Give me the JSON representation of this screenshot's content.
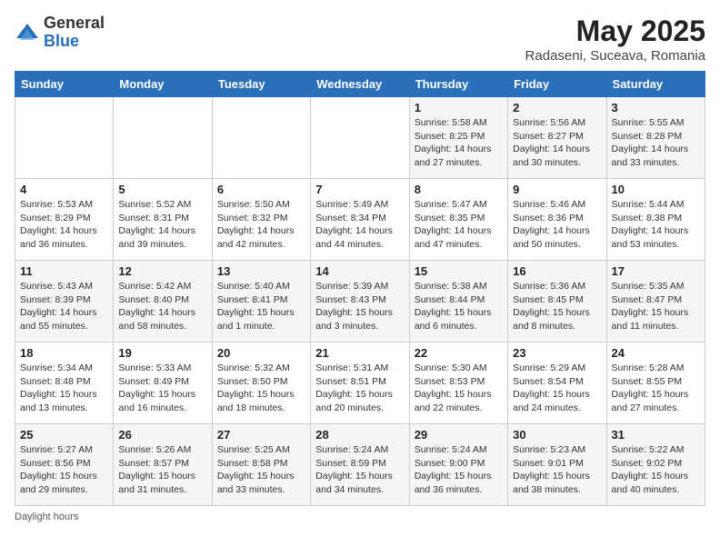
{
  "header": {
    "logo_general": "General",
    "logo_blue": "Blue",
    "month_title": "May 2025",
    "location": "Radaseni, Suceava, Romania"
  },
  "days_of_week": [
    "Sunday",
    "Monday",
    "Tuesday",
    "Wednesday",
    "Thursday",
    "Friday",
    "Saturday"
  ],
  "weeks": [
    [
      {
        "day": "",
        "info": ""
      },
      {
        "day": "",
        "info": ""
      },
      {
        "day": "",
        "info": ""
      },
      {
        "day": "",
        "info": ""
      },
      {
        "day": "1",
        "info": "Sunrise: 5:58 AM\nSunset: 8:25 PM\nDaylight: 14 hours\nand 27 minutes."
      },
      {
        "day": "2",
        "info": "Sunrise: 5:56 AM\nSunset: 8:27 PM\nDaylight: 14 hours\nand 30 minutes."
      },
      {
        "day": "3",
        "info": "Sunrise: 5:55 AM\nSunset: 8:28 PM\nDaylight: 14 hours\nand 33 minutes."
      }
    ],
    [
      {
        "day": "4",
        "info": "Sunrise: 5:53 AM\nSunset: 8:29 PM\nDaylight: 14 hours\nand 36 minutes."
      },
      {
        "day": "5",
        "info": "Sunrise: 5:52 AM\nSunset: 8:31 PM\nDaylight: 14 hours\nand 39 minutes."
      },
      {
        "day": "6",
        "info": "Sunrise: 5:50 AM\nSunset: 8:32 PM\nDaylight: 14 hours\nand 42 minutes."
      },
      {
        "day": "7",
        "info": "Sunrise: 5:49 AM\nSunset: 8:34 PM\nDaylight: 14 hours\nand 44 minutes."
      },
      {
        "day": "8",
        "info": "Sunrise: 5:47 AM\nSunset: 8:35 PM\nDaylight: 14 hours\nand 47 minutes."
      },
      {
        "day": "9",
        "info": "Sunrise: 5:46 AM\nSunset: 8:36 PM\nDaylight: 14 hours\nand 50 minutes."
      },
      {
        "day": "10",
        "info": "Sunrise: 5:44 AM\nSunset: 8:38 PM\nDaylight: 14 hours\nand 53 minutes."
      }
    ],
    [
      {
        "day": "11",
        "info": "Sunrise: 5:43 AM\nSunset: 8:39 PM\nDaylight: 14 hours\nand 55 minutes."
      },
      {
        "day": "12",
        "info": "Sunrise: 5:42 AM\nSunset: 8:40 PM\nDaylight: 14 hours\nand 58 minutes."
      },
      {
        "day": "13",
        "info": "Sunrise: 5:40 AM\nSunset: 8:41 PM\nDaylight: 15 hours\nand 1 minute."
      },
      {
        "day": "14",
        "info": "Sunrise: 5:39 AM\nSunset: 8:43 PM\nDaylight: 15 hours\nand 3 minutes."
      },
      {
        "day": "15",
        "info": "Sunrise: 5:38 AM\nSunset: 8:44 PM\nDaylight: 15 hours\nand 6 minutes."
      },
      {
        "day": "16",
        "info": "Sunrise: 5:36 AM\nSunset: 8:45 PM\nDaylight: 15 hours\nand 8 minutes."
      },
      {
        "day": "17",
        "info": "Sunrise: 5:35 AM\nSunset: 8:47 PM\nDaylight: 15 hours\nand 11 minutes."
      }
    ],
    [
      {
        "day": "18",
        "info": "Sunrise: 5:34 AM\nSunset: 8:48 PM\nDaylight: 15 hours\nand 13 minutes."
      },
      {
        "day": "19",
        "info": "Sunrise: 5:33 AM\nSunset: 8:49 PM\nDaylight: 15 hours\nand 16 minutes."
      },
      {
        "day": "20",
        "info": "Sunrise: 5:32 AM\nSunset: 8:50 PM\nDaylight: 15 hours\nand 18 minutes."
      },
      {
        "day": "21",
        "info": "Sunrise: 5:31 AM\nSunset: 8:51 PM\nDaylight: 15 hours\nand 20 minutes."
      },
      {
        "day": "22",
        "info": "Sunrise: 5:30 AM\nSunset: 8:53 PM\nDaylight: 15 hours\nand 22 minutes."
      },
      {
        "day": "23",
        "info": "Sunrise: 5:29 AM\nSunset: 8:54 PM\nDaylight: 15 hours\nand 24 minutes."
      },
      {
        "day": "24",
        "info": "Sunrise: 5:28 AM\nSunset: 8:55 PM\nDaylight: 15 hours\nand 27 minutes."
      }
    ],
    [
      {
        "day": "25",
        "info": "Sunrise: 5:27 AM\nSunset: 8:56 PM\nDaylight: 15 hours\nand 29 minutes."
      },
      {
        "day": "26",
        "info": "Sunrise: 5:26 AM\nSunset: 8:57 PM\nDaylight: 15 hours\nand 31 minutes."
      },
      {
        "day": "27",
        "info": "Sunrise: 5:25 AM\nSunset: 8:58 PM\nDaylight: 15 hours\nand 33 minutes."
      },
      {
        "day": "28",
        "info": "Sunrise: 5:24 AM\nSunset: 8:59 PM\nDaylight: 15 hours\nand 34 minutes."
      },
      {
        "day": "29",
        "info": "Sunrise: 5:24 AM\nSunset: 9:00 PM\nDaylight: 15 hours\nand 36 minutes."
      },
      {
        "day": "30",
        "info": "Sunrise: 5:23 AM\nSunset: 9:01 PM\nDaylight: 15 hours\nand 38 minutes."
      },
      {
        "day": "31",
        "info": "Sunrise: 5:22 AM\nSunset: 9:02 PM\nDaylight: 15 hours\nand 40 minutes."
      }
    ]
  ],
  "footer": {
    "daylight_label": "Daylight hours"
  }
}
